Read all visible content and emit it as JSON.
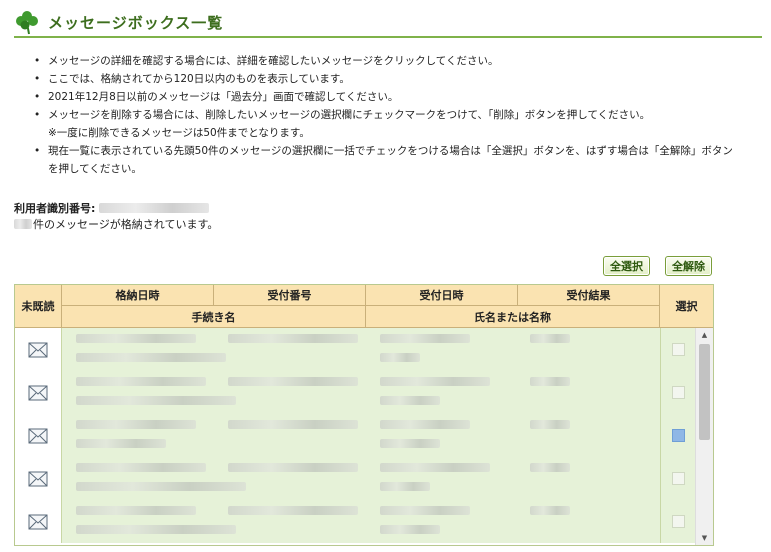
{
  "page": {
    "title": "メッセージボックス一覧"
  },
  "notes": [
    "メッセージの詳細を確認する場合には、詳細を確認したいメッセージをクリックしてください。",
    "ここでは、格納されてから120日以内のものを表示しています。",
    "2021年12月8日以前のメッセージは「過去分」画面で確認してください。",
    "メッセージを削除する場合には、削除したいメッセージの選択欄にチェックマークをつけて、「削除」ボタンを押してください。",
    "※一度に削除できるメッセージは50件までとなります。",
    "現在一覧に表示されている先頭50件のメッセージの選択欄に一括でチェックをつける場合は「全選択」ボタンを、はずす場合は「全解除」ボタン",
    "を押してください。"
  ],
  "user": {
    "id_label": "利用者識別番号:",
    "count_suffix": "件のメッセージが格納されています。"
  },
  "buttons": {
    "select_all": "全選択",
    "clear_all": "全解除"
  },
  "table": {
    "headers": {
      "unread": "未既読",
      "stored_date": "格納日時",
      "receipt_number": "受付番号",
      "receipt_date": "受付日時",
      "receipt_result": "受付結果",
      "procedure_name": "手続き名",
      "name": "氏名または名称",
      "select": "選択"
    },
    "rows": [
      {
        "checked": false
      },
      {
        "checked": false
      },
      {
        "checked": true
      },
      {
        "checked": false
      },
      {
        "checked": false
      }
    ]
  },
  "colors": {
    "accent_green": "#7fb24a",
    "title_green": "#3d6e1e",
    "header_bg": "#fae3b1",
    "row_bg": "#e6f2d8"
  },
  "icons": {
    "title": "clover-icon",
    "row": "envelope-icon"
  }
}
